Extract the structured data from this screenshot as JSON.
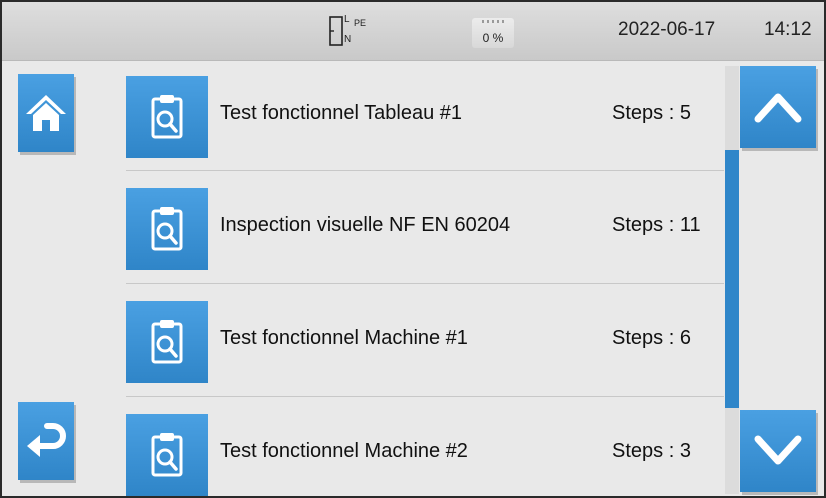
{
  "status_bar": {
    "connection_labels": {
      "top": "L",
      "bottom": "N",
      "pe": "PE"
    },
    "battery_percent": "0 %",
    "date": "2022-06-17",
    "time": "14:12"
  },
  "navigation": {
    "home_icon": "home-icon",
    "back_icon": "return-arrow-icon",
    "scroll_up_icon": "chevron-up-icon",
    "scroll_down_icon": "chevron-down-icon"
  },
  "list": {
    "item_icon": "clipboard-search-icon",
    "items": [
      {
        "name": "Test fonctionnel Tableau #1",
        "steps": "Steps : 5"
      },
      {
        "name": "Inspection visuelle NF EN 60204",
        "steps": "Steps : 11"
      },
      {
        "name": "Test fonctionnel Machine #1",
        "steps": "Steps : 6"
      },
      {
        "name": "Test fonctionnel Machine #2",
        "steps": "Steps : 3"
      }
    ]
  },
  "scrollbar": {
    "visible_fraction": 0.6,
    "position_fraction": 0.2
  },
  "colors": {
    "accent": "#3a93d6",
    "background": "#e9e9e9",
    "status_bar": "#d3d3d3",
    "text": "#111111"
  }
}
